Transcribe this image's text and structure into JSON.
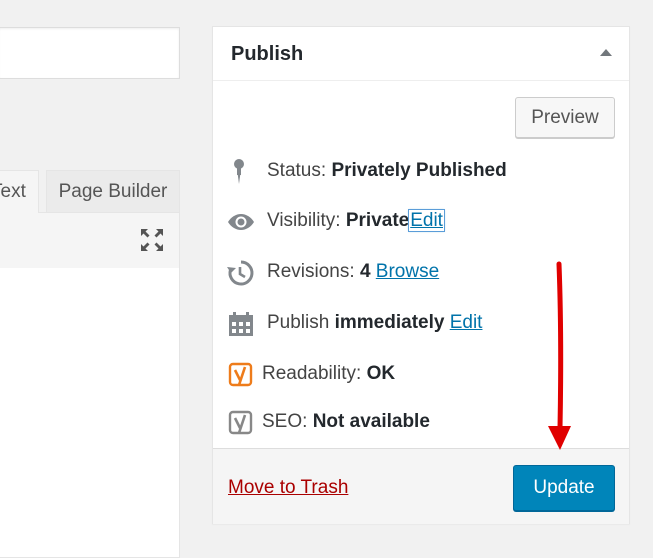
{
  "editor": {
    "tabs": [
      {
        "label": "Text"
      },
      {
        "label": "Page Builder"
      }
    ]
  },
  "publish": {
    "title": "Publish",
    "preview_label": "Preview",
    "status": {
      "label": "Status:",
      "value": "Privately Published",
      "icon": "pin-icon"
    },
    "visibility": {
      "label": "Visibility:",
      "value": "Private",
      "edit": "Edit",
      "icon": "eye-icon"
    },
    "revisions": {
      "label": "Revisions:",
      "value": "4",
      "link": "Browse",
      "icon": "history-icon"
    },
    "schedule": {
      "label": "Publish",
      "value": "immediately",
      "edit": "Edit",
      "icon": "calendar-icon"
    },
    "readability": {
      "label": "Readability:",
      "value": "OK",
      "icon": "yoast-icon",
      "icon_color": "#ee7c1b"
    },
    "seo": {
      "label": "SEO:",
      "value": "Not available",
      "icon": "yoast-icon",
      "icon_color": "#888888"
    },
    "trash_label": "Move to Trash",
    "update_label": "Update"
  },
  "colors": {
    "primary_button": "#0085ba",
    "link": "#0073aa",
    "trash": "#aa0000",
    "annotation_arrow": "#e00000"
  }
}
